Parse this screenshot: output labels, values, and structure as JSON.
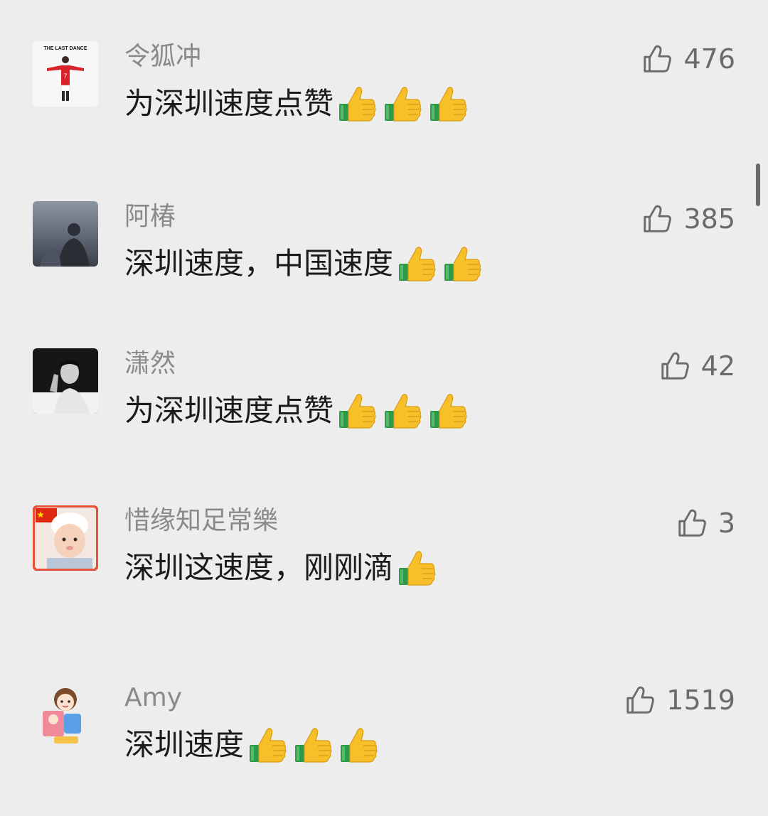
{
  "comments": [
    {
      "name": "令狐冲",
      "text": "为深圳速度点赞",
      "thumbs": 3,
      "likes": "476",
      "avatar": "the-last-dance-jersey-avatar",
      "avatar_text": "THE LAST DANCE"
    },
    {
      "name": "阿椿",
      "text": "深圳速度，中国速度",
      "thumbs": 2,
      "likes": "385",
      "avatar": "dusk-photo-avatar"
    },
    {
      "name": "潇然",
      "text": "为深圳速度点赞",
      "thumbs": 3,
      "likes": "42",
      "avatar": "bw-portrait-avatar"
    },
    {
      "name": "惜缘知足常樂",
      "text": "深圳这速度，刚刚滴",
      "thumbs": 1,
      "likes": "3",
      "avatar": "baby-with-flag-avatar"
    },
    {
      "name": "Amy",
      "text": "深圳速度",
      "thumbs": 3,
      "likes": "1519",
      "avatar": "cartoon-kids-avatar"
    }
  ],
  "colors": {
    "background": "#ededed",
    "name_gray": "#8a8a8a",
    "text_black": "#1b1b1b",
    "like_gray": "#6b6b6b",
    "thumb_yellow": "#f7c02b",
    "cuff_green": "#2e9a45",
    "flag_red": "#de2910"
  },
  "icons": {
    "like": "thumbs-up-outline-icon",
    "emoji": "thumbs-up-emoji"
  }
}
